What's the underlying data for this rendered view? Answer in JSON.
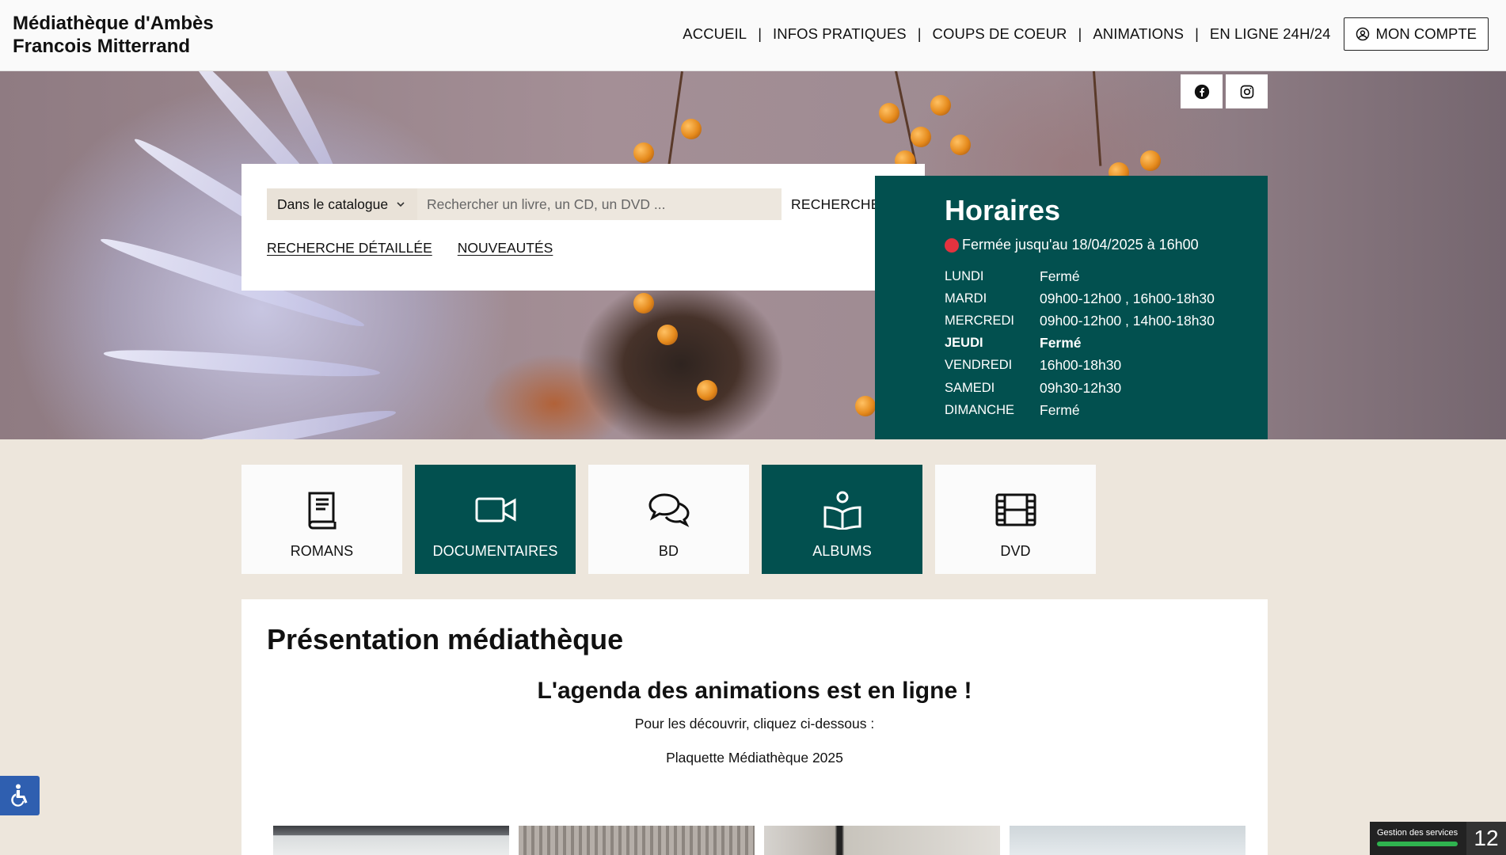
{
  "site": {
    "title_line1": "Médiathèque d'Ambès",
    "title_line2": "Francois Mitterrand"
  },
  "nav": {
    "items": [
      "ACCUEIL",
      "INFOS PRATIQUES",
      "COUPS DE COEUR",
      "ANIMATIONS",
      "EN LIGNE 24H/24"
    ],
    "account_label": "MON COMPTE"
  },
  "social": {
    "icons": [
      "facebook-icon",
      "instagram-icon"
    ]
  },
  "search": {
    "scope_selected": "Dans le catalogue",
    "placeholder": "Rechercher un livre, un CD, un DVD ...",
    "button_label": "RECHERCHER",
    "links": [
      "RECHERCHE DÉTAILLÉE",
      "NOUVEAUTÉS"
    ]
  },
  "hours": {
    "title": "Horaires",
    "status": "Fermée jusqu'au 18/04/2025 à 16h00",
    "status_color": "#e3333f",
    "rows": [
      {
        "day": "LUNDI",
        "time": "Fermé"
      },
      {
        "day": "MARDI",
        "time": "09h00-12h00 , 16h00-18h30"
      },
      {
        "day": "MERCREDI",
        "time": "09h00-12h00 , 14h00-18h30"
      },
      {
        "day": "JEUDI",
        "time": "Fermé"
      },
      {
        "day": "VENDREDI",
        "time": "16h00-18h30"
      },
      {
        "day": "SAMEDI",
        "time": "09h30-12h30"
      },
      {
        "day": "DIMANCHE",
        "time": "Fermé"
      }
    ],
    "today_index": 3
  },
  "categories": [
    {
      "label": "ROMANS",
      "icon": "book-icon",
      "dark": false
    },
    {
      "label": "DOCUMENTAIRES",
      "icon": "video-camera-icon",
      "dark": true
    },
    {
      "label": "BD",
      "icon": "speech-bubbles-icon",
      "dark": false
    },
    {
      "label": "ALBUMS",
      "icon": "reader-icon",
      "dark": true
    },
    {
      "label": "DVD",
      "icon": "film-icon",
      "dark": false
    }
  ],
  "presentation": {
    "title": "Présentation médiathèque",
    "heading": "L'agenda des animations est en ligne !",
    "intro": "Pour les découvrir, cliquez ci-dessous :",
    "link": "Plaquette Médiathèque 2025"
  },
  "cookie": {
    "label": "Gestion des services",
    "count": "12"
  },
  "colors": {
    "accent": "#02504f",
    "page_bg": "#ede6dc",
    "a11y": "#2f5fb0"
  }
}
